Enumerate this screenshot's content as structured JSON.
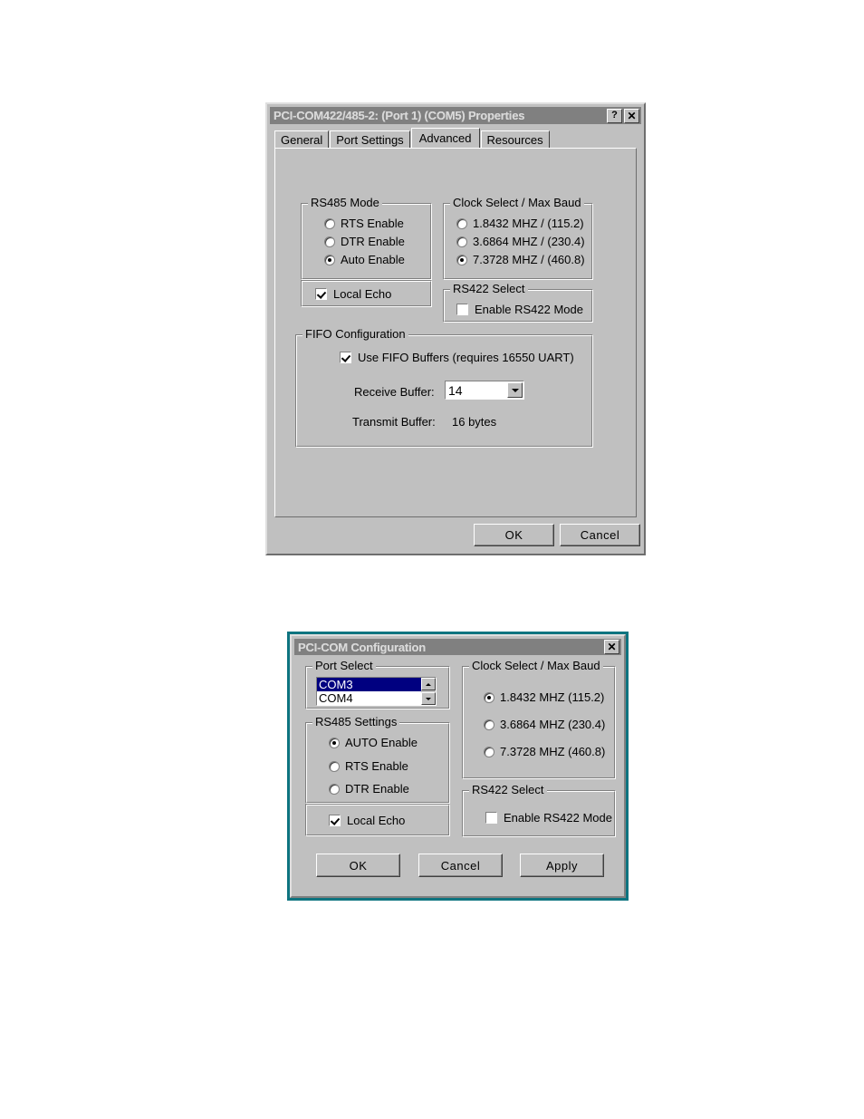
{
  "dialog1": {
    "title": "PCI-COM422/485-2: (Port 1) (COM5) Properties",
    "titlebar_buttons": [
      {
        "name": "help-button",
        "glyph": "?"
      },
      {
        "name": "close-button",
        "glyph": "✕"
      }
    ],
    "tabs": [
      {
        "label": "General",
        "active": false
      },
      {
        "label": "Port Settings",
        "active": false
      },
      {
        "label": "Advanced",
        "active": true
      },
      {
        "label": "Resources",
        "active": false
      }
    ],
    "rs485_mode": {
      "title": "RS485 Mode",
      "options": [
        {
          "label": "RTS Enable",
          "selected": false
        },
        {
          "label": "DTR Enable",
          "selected": false
        },
        {
          "label": "Auto Enable",
          "selected": true
        }
      ]
    },
    "local_echo": {
      "label": "Local Echo",
      "checked": true
    },
    "clock_select": {
      "title": "Clock Select / Max Baud",
      "options": [
        {
          "label": "1.8432 MHZ / (115.2)",
          "selected": false
        },
        {
          "label": "3.6864 MHZ / (230.4)",
          "selected": false
        },
        {
          "label": "7.3728 MHZ / (460.8)",
          "selected": true
        }
      ]
    },
    "rs422_select": {
      "title": "RS422 Select",
      "label": "Enable RS422 Mode",
      "checked": false
    },
    "fifo": {
      "title": "FIFO Configuration",
      "use_fifo_label": "Use FIFO Buffers (requires 16550 UART)",
      "use_fifo_checked": true,
      "receive_label": "Receive Buffer:",
      "receive_value": "14",
      "transmit_label": "Transmit Buffer:",
      "transmit_value": "16 bytes"
    },
    "buttons": {
      "ok": "OK",
      "cancel": "Cancel"
    }
  },
  "dialog2": {
    "title": "PCI-COM Configuration",
    "titlebar_buttons": [
      {
        "name": "close-button",
        "glyph": "✕"
      }
    ],
    "port_select": {
      "title": "Port Select",
      "items": [
        {
          "label": "COM3",
          "selected": true
        },
        {
          "label": "COM4",
          "selected": false
        }
      ]
    },
    "rs485_settings": {
      "title": "RS485 Settings",
      "options": [
        {
          "label": "AUTO Enable",
          "selected": true
        },
        {
          "label": "RTS Enable",
          "selected": false
        },
        {
          "label": "DTR Enable",
          "selected": false
        }
      ]
    },
    "local_echo": {
      "label": "Local Echo",
      "checked": true
    },
    "clock_select": {
      "title": "Clock Select / Max Baud",
      "options": [
        {
          "label": "1.8432 MHZ (115.2)",
          "selected": true
        },
        {
          "label": "3.6864 MHZ (230.4)",
          "selected": false
        },
        {
          "label": "7.3728 MHZ (460.8)",
          "selected": false
        }
      ]
    },
    "rs422_select": {
      "title": "RS422 Select",
      "label": "Enable RS422 Mode",
      "checked": false
    },
    "buttons": {
      "ok": "OK",
      "cancel": "Cancel",
      "apply": "Apply"
    }
  },
  "colors": {
    "face": "#c0c0c0",
    "titlebar_inactive": "#808080",
    "selection": "#000080",
    "dialog2_border": "#0e7480"
  }
}
